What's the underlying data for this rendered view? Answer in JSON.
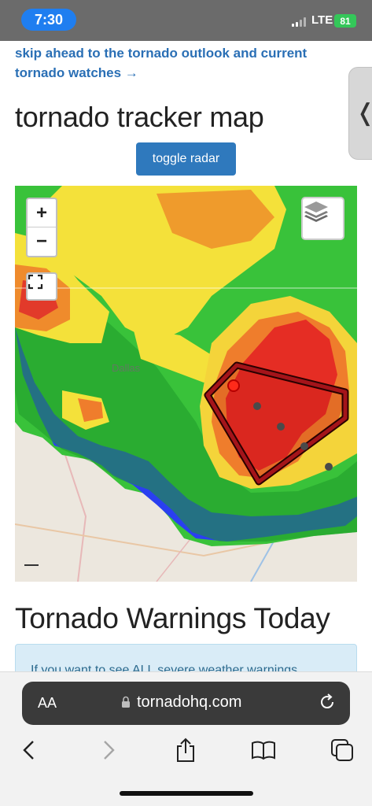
{
  "status_bar": {
    "time": "7:30",
    "network": "LTE",
    "battery": "81"
  },
  "page": {
    "skip_link": "skip ahead to the tornado outlook and current tornado watches →",
    "title": "tornado tracker map",
    "toggle_button": "toggle radar",
    "section_title": "Tornado Warnings Today",
    "info_text": "If you want to see ALL severe weather warnings"
  },
  "map": {
    "zoom_in": "+",
    "zoom_out": "−",
    "city_label": "Dallas",
    "controls": [
      "zoom-in",
      "zoom-out",
      "fullscreen",
      "layers"
    ]
  },
  "browser": {
    "text_size": "AA",
    "url": "tornadohq.com"
  },
  "icons": [
    "signal-icon",
    "battery-icon",
    "lock-icon",
    "reload-icon",
    "back-icon",
    "forward-icon",
    "share-icon",
    "bookmarks-icon",
    "tabs-icon",
    "layers-icon",
    "fullscreen-icon",
    "side-tab-chevron-icon"
  ],
  "colors": {
    "link": "#2a6fb5",
    "button": "#2f79bd",
    "time_pill": "#1f7ef0",
    "battery": "#34c759",
    "warning_polygon": "#8b0000"
  }
}
